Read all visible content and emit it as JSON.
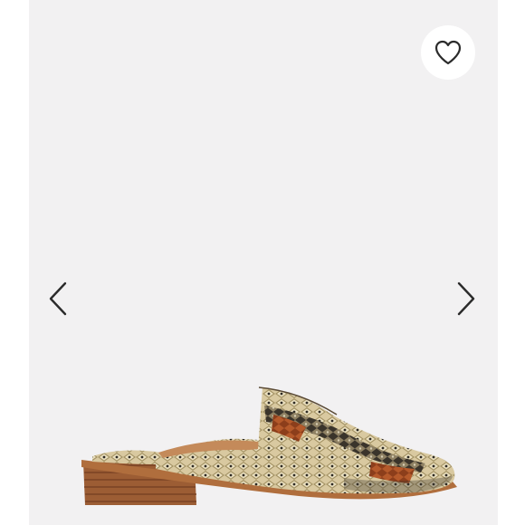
{
  "viewer": {
    "favorite": {
      "icon": "heart-outline-icon",
      "label": ""
    },
    "previous": {
      "icon": "chevron-left-icon"
    },
    "next": {
      "icon": "chevron-right-icon"
    },
    "product_image": {
      "subject": "snakeskin-mule-shoe"
    }
  },
  "colors": {
    "page_background": "#ffffff",
    "photo_background": "#f2f1f2",
    "icon_stroke": "#2b2b2b",
    "favorite_background": "#ffffff"
  }
}
